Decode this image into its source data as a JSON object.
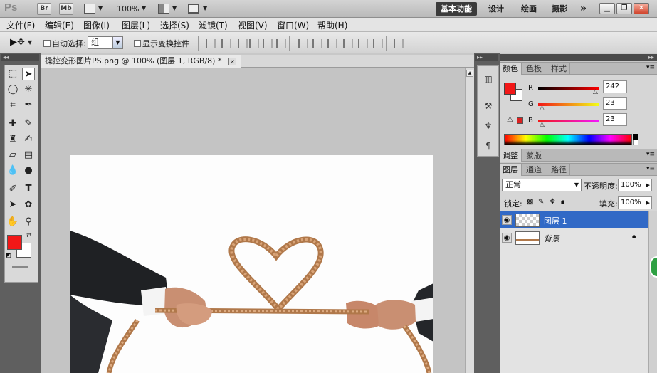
{
  "app": {
    "logo": "Ps",
    "bridge_btn": "Br",
    "mini_bridge_btn": "Mb",
    "zoom": "100%",
    "workspaces": [
      "基本功能",
      "设计",
      "绘画",
      "摄影"
    ],
    "more": "»"
  },
  "menu": [
    "文件(F)",
    "编辑(E)",
    "图像(I)",
    "图层(L)",
    "选择(S)",
    "滤镜(T)",
    "视图(V)",
    "窗口(W)",
    "帮助(H)"
  ],
  "options": {
    "auto_select_label": "自动选择:",
    "auto_select_value": "组",
    "show_transform_label": "显示变换控件"
  },
  "document": {
    "tab_title": "操控变形图片PS.png @ 100% (图层 1, RGB/8) *",
    "close": "×"
  },
  "colors": {
    "foreground": "#f21717",
    "background": "#ffffff",
    "accent_selected": "#3169c6"
  },
  "color_panel": {
    "tabs": [
      "颜色",
      "色板",
      "样式"
    ],
    "r_label": "R",
    "r_value": "242",
    "g_label": "G",
    "g_value": "23",
    "b_label": "B",
    "b_value": "23"
  },
  "adjust_panel": {
    "tabs": [
      "调整",
      "蒙版"
    ]
  },
  "layers_panel": {
    "tabs": [
      "图层",
      "通道",
      "路径"
    ],
    "blend_mode": "正常",
    "opacity_label": "不透明度:",
    "opacity": "100%",
    "lock_label": "锁定:",
    "fill_label": "填充:",
    "fill": "100%",
    "layers": [
      {
        "name": "图层 1",
        "selected": true
      },
      {
        "name": "背景",
        "selected": false,
        "locked": true
      }
    ]
  },
  "icons": [
    "move-tool-icon",
    "marquee-icon",
    "lasso-icon",
    "magic-wand-icon",
    "crop-icon",
    "eyedropper-icon",
    "healing-brush-icon",
    "brush-icon",
    "clone-stamp-icon",
    "history-brush-icon",
    "eraser-icon",
    "gradient-icon",
    "blur-icon",
    "dodge-icon",
    "pen-icon",
    "type-icon",
    "path-select-icon",
    "shape-icon",
    "hand-icon",
    "zoom-icon",
    "eye-icon",
    "lock-icon"
  ]
}
